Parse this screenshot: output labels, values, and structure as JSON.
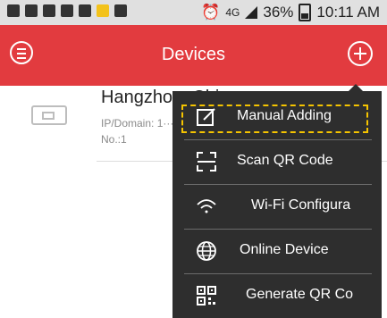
{
  "status_bar": {
    "signal_small": "4G",
    "battery_percent": "36%",
    "time": "10:11 AM"
  },
  "app_bar": {
    "title": "Devices",
    "menu_icon": "hamburger-icon",
    "add_icon": "plus-icon"
  },
  "device": {
    "name": "Hangzhou, China",
    "ip": "IP/Domain: 1···",
    "channel": "No.:1"
  },
  "menu": {
    "items": [
      {
        "label": "Manual Adding",
        "icon": "edit-icon"
      },
      {
        "label": "Scan QR Code",
        "icon": "scan-icon"
      },
      {
        "label": "Wi-Fi Configura",
        "icon": "wifi-icon"
      },
      {
        "label": "Online Device",
        "icon": "globe-icon"
      },
      {
        "label": "Generate QR Co",
        "icon": "qr-code-icon"
      }
    ]
  },
  "colors": {
    "app_bar": "#e23b3f",
    "menu_bg": "#2e2e2e",
    "highlight": "#f5c400"
  }
}
